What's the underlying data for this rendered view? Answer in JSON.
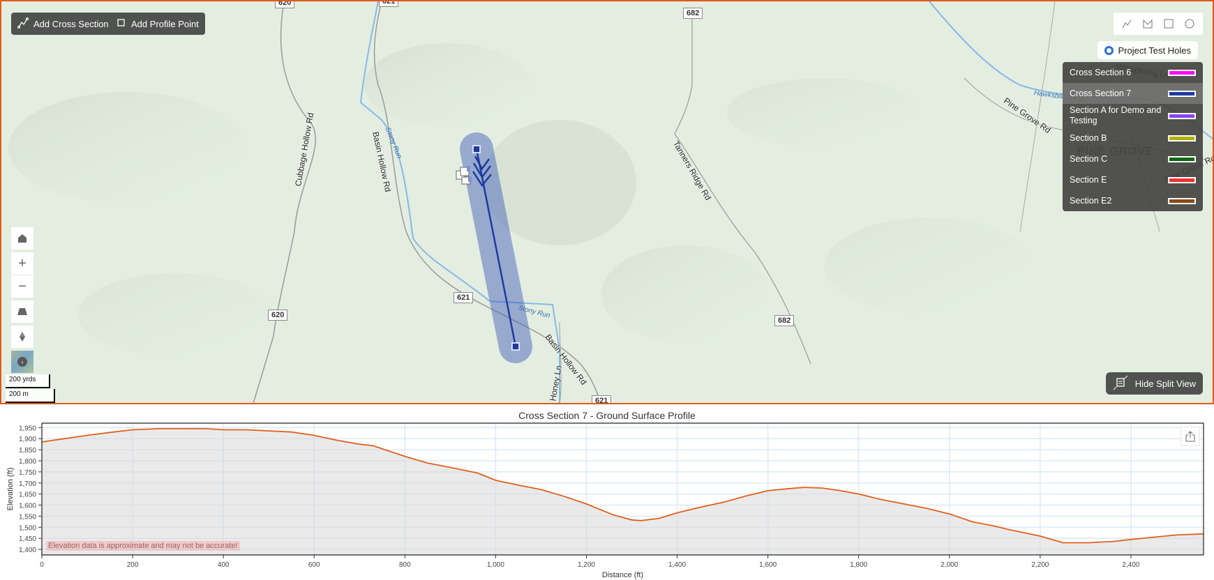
{
  "toolbar": {
    "add_cross_section_label": "Add Cross Section",
    "add_profile_point_label": "Add Profile Point"
  },
  "draw_tools": [
    "polyline-icon",
    "polygon-icon",
    "rectangle-icon",
    "circle-icon"
  ],
  "layers": {
    "project_test_holes_label": "Project Test Holes"
  },
  "legend": {
    "items": [
      {
        "label": "Cross Section 6",
        "color": "#ff00ff",
        "selected": false
      },
      {
        "label": "Cross Section 7",
        "color": "#1f3aa0",
        "selected": true
      },
      {
        "label": "Section A for Demo and Testing",
        "color": "#8a44f0",
        "selected": false
      },
      {
        "label": "Section B",
        "color": "#b0b000",
        "selected": false
      },
      {
        "label": "Section C",
        "color": "#0a6a10",
        "selected": false
      },
      {
        "label": "Section E",
        "color": "#f03030",
        "selected": false
      },
      {
        "label": "Section E2",
        "color": "#8a4a12",
        "selected": false
      }
    ]
  },
  "nav": {
    "home": "home-icon",
    "zoom_in": "+",
    "zoom_out": "−",
    "tilt": "tilt-icon",
    "compass": "compass-icon",
    "basemap": "basemap-toggle"
  },
  "scale": {
    "imperial": "200 yrds",
    "metric": "200 m"
  },
  "split_view": {
    "label": "Hide Split View"
  },
  "map_labels": {
    "roads": [
      "Cubbage Hollow Rd",
      "Basin Hollow Rd",
      "Basin Hollow Rd",
      "Tanners Ridge Rd",
      "Pine Grove Rd",
      "Pine Grove Rd",
      "Honey Ln"
    ],
    "water": [
      "Stony Run",
      "Stony Run",
      "Hawksbill Creek"
    ],
    "places": [
      "PINE GROVE"
    ],
    "shields": [
      "682",
      "621",
      "620",
      "682",
      "621",
      "620"
    ],
    "partial": [
      "Whispering Ln"
    ]
  },
  "colors": {
    "accent_border": "#e05a1a",
    "profile_line": "#e0601c",
    "cross_section_line": "#1f3aa0"
  },
  "chart_data": {
    "type": "area",
    "title": "Cross Section 7 - Ground Surface Profile",
    "xlabel": "Distance (ft)",
    "ylabel": "Elevation (ft)",
    "xlim": [
      0,
      2560
    ],
    "ylim": [
      1375,
      1970
    ],
    "xticks": [
      0,
      200,
      400,
      600,
      800,
      1000,
      1200,
      1400,
      1600,
      1800,
      2000,
      2200,
      2400
    ],
    "xtick_labels": [
      "0",
      "200",
      "400",
      "600",
      "800",
      "1,000",
      "1,200",
      "1,400",
      "1,600",
      "1,800",
      "2,000",
      "2,200",
      "2,400"
    ],
    "yticks": [
      1400,
      1450,
      1500,
      1550,
      1600,
      1650,
      1700,
      1750,
      1800,
      1850,
      1900,
      1950
    ],
    "ytick_labels": [
      "1,400",
      "1,450",
      "1,500",
      "1,550",
      "1,600",
      "1,650",
      "1,700",
      "1,750",
      "1,800",
      "1,850",
      "1,900",
      "1,950"
    ],
    "grid": true,
    "annotation": "Elevation data is approximate and may not be accurate!",
    "series": [
      {
        "name": "Ground Surface",
        "x": [
          0,
          50,
          100,
          150,
          200,
          260,
          360,
          400,
          450,
          550,
          600,
          650,
          700,
          730,
          800,
          850,
          900,
          960,
          1000,
          1050,
          1100,
          1150,
          1200,
          1260,
          1300,
          1320,
          1360,
          1400,
          1450,
          1500,
          1550,
          1600,
          1640,
          1680,
          1720,
          1760,
          1800,
          1850,
          1900,
          1950,
          2000,
          2050,
          2100,
          2130,
          2200,
          2250,
          2310,
          2330,
          2360,
          2400,
          2450,
          2500,
          2560
        ],
        "y": [
          1885,
          1900,
          1915,
          1928,
          1940,
          1945,
          1945,
          1940,
          1940,
          1930,
          1915,
          1893,
          1875,
          1868,
          1820,
          1790,
          1770,
          1745,
          1712,
          1690,
          1670,
          1640,
          1605,
          1555,
          1533,
          1530,
          1540,
          1565,
          1590,
          1612,
          1640,
          1665,
          1673,
          1680,
          1677,
          1665,
          1650,
          1625,
          1605,
          1585,
          1560,
          1525,
          1505,
          1490,
          1460,
          1430,
          1430,
          1433,
          1435,
          1445,
          1455,
          1465,
          1470
        ]
      }
    ]
  }
}
